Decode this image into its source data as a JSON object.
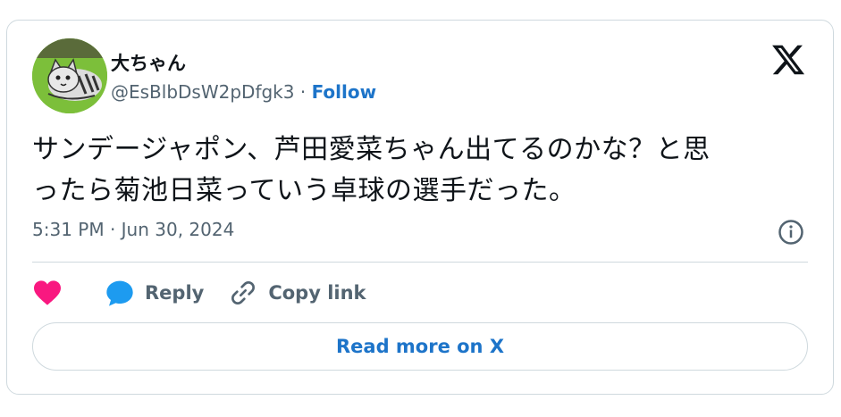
{
  "user": {
    "display_name": "大ちゃん",
    "handle": "@EsBlbDsW2pDfgk3",
    "separator": "·",
    "follow_label": "Follow"
  },
  "tweet": {
    "text_line1": "サンデージャポン、芦田愛菜ちゃん出てるのかな？と思",
    "text_line2": "ったら菊池日菜っていう卓球の選手だった。",
    "timestamp": "5:31 PM · Jun 30, 2024"
  },
  "actions": {
    "reply_label": "Reply",
    "copy_link_label": "Copy link"
  },
  "read_more_label": "Read more on X",
  "icons": {
    "logo": "x-logo-icon",
    "info": "info-icon",
    "like": "heart-icon",
    "reply": "reply-bubble-icon",
    "copy": "link-icon"
  },
  "colors": {
    "accent": "#1d74c9",
    "heart": "#f91880",
    "reply_icon": "#1d9bf0",
    "muted": "#536471",
    "border": "#cfd9de"
  }
}
